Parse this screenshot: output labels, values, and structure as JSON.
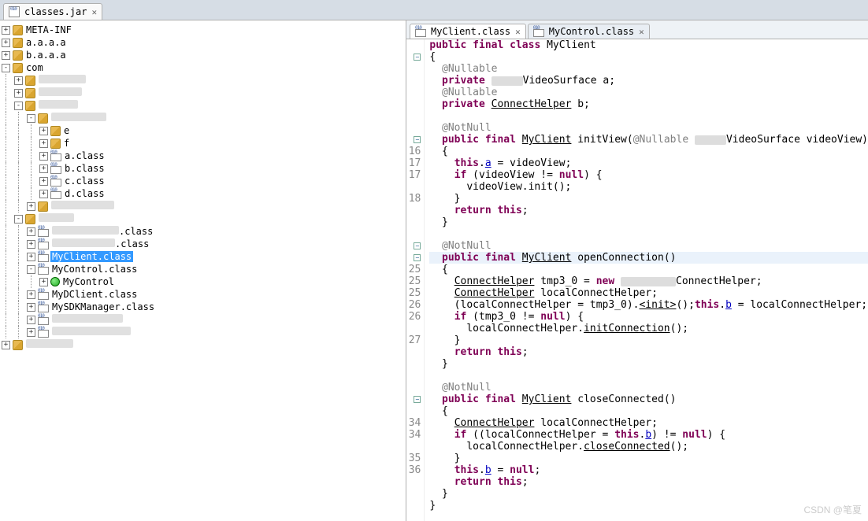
{
  "topTab": {
    "title": "classes.jar"
  },
  "tree": [
    {
      "d": 0,
      "exp": "-",
      "icon": "class",
      "label": "",
      "blurW": 0,
      "sel": false,
      "isBlur": false,
      "hideLabel": true
    },
    {
      "d": 0,
      "exp": "+",
      "icon": "pkg",
      "label": "META-INF"
    },
    {
      "d": 0,
      "exp": "+",
      "icon": "pkg",
      "label": "a.a.a.a"
    },
    {
      "d": 0,
      "exp": "+",
      "icon": "pkg",
      "label": "b.a.a.a"
    },
    {
      "d": 0,
      "exp": "-",
      "icon": "pkg",
      "label": "com"
    },
    {
      "d": 1,
      "exp": "+",
      "icon": "pkg",
      "label": "",
      "isBlur": true,
      "blurW": 60
    },
    {
      "d": 1,
      "exp": "+",
      "icon": "pkg",
      "label": "",
      "isBlur": true,
      "blurW": 55
    },
    {
      "d": 1,
      "exp": "-",
      "icon": "pkg",
      "label": "",
      "isBlur": true,
      "blurW": 50
    },
    {
      "d": 2,
      "exp": "-",
      "icon": "pkg",
      "label": "",
      "isBlur": true,
      "blurW": 70
    },
    {
      "d": 3,
      "exp": "+",
      "icon": "pkg",
      "label": "e"
    },
    {
      "d": 3,
      "exp": "+",
      "icon": "pkg",
      "label": "f"
    },
    {
      "d": 3,
      "exp": "+",
      "icon": "class",
      "label": "a.class"
    },
    {
      "d": 3,
      "exp": "+",
      "icon": "class",
      "label": "b.class"
    },
    {
      "d": 3,
      "exp": "+",
      "icon": "class",
      "label": "c.class"
    },
    {
      "d": 3,
      "exp": "+",
      "icon": "class",
      "label": "d.class"
    },
    {
      "d": 2,
      "exp": "+",
      "icon": "pkg",
      "label": "",
      "isBlur": true,
      "blurW": 80
    },
    {
      "d": 1,
      "exp": "-",
      "icon": "pkg",
      "label": "",
      "isBlur": true,
      "blurW": 45
    },
    {
      "d": 2,
      "exp": "+",
      "icon": "class",
      "label": ".class",
      "prefixBlur": 85
    },
    {
      "d": 2,
      "exp": "+",
      "icon": "class",
      "label": ".class",
      "prefixBlur": 80
    },
    {
      "d": 2,
      "exp": "+",
      "icon": "class",
      "label": "MyClient.class",
      "sel": true
    },
    {
      "d": 2,
      "exp": "-",
      "icon": "class",
      "label": "MyControl.class"
    },
    {
      "d": 3,
      "exp": "+",
      "icon": "green",
      "label": "MyControl"
    },
    {
      "d": 2,
      "exp": "+",
      "icon": "class",
      "label": "MyDClient.class"
    },
    {
      "d": 2,
      "exp": "+",
      "icon": "class",
      "label": "MySDKManager.class"
    },
    {
      "d": 2,
      "exp": "+",
      "icon": "class",
      "label": "",
      "isBlur": true,
      "blurW": 90
    },
    {
      "d": 2,
      "exp": "+",
      "icon": "class",
      "label": "",
      "isBlur": true,
      "blurW": 100
    },
    {
      "d": 0,
      "exp": "+",
      "icon": "pkg",
      "label": "",
      "isBlur": true,
      "blurW": 60
    }
  ],
  "editorTabs": [
    {
      "label": "MyClient.class",
      "active": true
    },
    {
      "label": "MyControl.class",
      "active": false
    }
  ],
  "gutter": [
    "",
    "",
    "",
    "",
    "",
    "",
    "",
    "",
    "",
    "16",
    "17",
    "17",
    "",
    "18",
    "",
    "",
    "",
    "",
    "",
    "25",
    "25",
    "25",
    "26",
    "26",
    "",
    "27",
    "",
    "",
    "",
    "",
    "",
    "",
    "34",
    "34",
    "",
    "35",
    "36",
    "",
    ""
  ],
  "folds": {
    "1": "-",
    "8": "-",
    "17": "-",
    "18": "-",
    "30": "-"
  },
  "code": [
    {
      "html": "<span class='kw'>public</span> <span class='kw'>final</span> <span class='kw'>class</span> MyClient"
    },
    {
      "html": "{"
    },
    {
      "html": "  <span class='ann'>@Nullable</span>"
    },
    {
      "html": "  <span class='kw'>private</span> <span class='blur-inline'></span>VideoSurface a;"
    },
    {
      "html": "  <span class='ann'>@Nullable</span>"
    },
    {
      "html": "  <span class='kw'>private</span> <span class='typ'>ConnectHelper</span> b;"
    },
    {
      "html": "  "
    },
    {
      "html": "  <span class='ann'>@NotNull</span>"
    },
    {
      "html": "  <span class='kw'>public</span> <span class='kw'>final</span> <span class='typ'>MyClient</span> initView(<span class='ann'>@Nullable</span> <span class='blur-inline'></span>VideoSurface videoView)"
    },
    {
      "html": "  {"
    },
    {
      "html": "    <span class='kw'>this</span>.<span class='fld'>a</span> = videoView;"
    },
    {
      "html": "    <span class='kw'>if</span> (videoView != <span class='kw'>null</span>) {"
    },
    {
      "html": "      videoView.init();"
    },
    {
      "html": "    }"
    },
    {
      "html": "    <span class='kw'>return</span> <span class='kw'>this</span>;"
    },
    {
      "html": "  }"
    },
    {
      "html": "  "
    },
    {
      "html": "  <span class='ann'>@NotNull</span>"
    },
    {
      "html": "  <span class='kw'>public</span> <span class='kw'>final</span> <span class='typ'>MyClient</span> openConnection()",
      "hl": true
    },
    {
      "html": "  {"
    },
    {
      "html": "    <span class='typ'>ConnectHelper</span> tmp3_0 = <span class='kw'>new</span> <span class='blur-inline' style='width:70px'></span>ConnectHelper;"
    },
    {
      "html": "    <span class='typ'>ConnectHelper</span> localConnectHelper;"
    },
    {
      "html": "    (localConnectHelper = tmp3_0).<span class='mtd'>&lt;init&gt;</span>();<span class='kw'>this</span>.<span class='fld'>b</span> = localConnectHelper;"
    },
    {
      "html": "    <span class='kw'>if</span> (tmp3_0 != <span class='kw'>null</span>) {"
    },
    {
      "html": "      localConnectHelper.<span class='mtd'>initConnection</span>();"
    },
    {
      "html": "    }"
    },
    {
      "html": "    <span class='kw'>return</span> <span class='kw'>this</span>;"
    },
    {
      "html": "  }"
    },
    {
      "html": "  "
    },
    {
      "html": "  <span class='ann'>@NotNull</span>"
    },
    {
      "html": "  <span class='kw'>public</span> <span class='kw'>final</span> <span class='typ'>MyClient</span> closeConnected()"
    },
    {
      "html": "  {"
    },
    {
      "html": "    <span class='typ'>ConnectHelper</span> localConnectHelper;"
    },
    {
      "html": "    <span class='kw'>if</span> ((localConnectHelper = <span class='kw'>this</span>.<span class='fld'>b</span>) != <span class='kw'>null</span>) {"
    },
    {
      "html": "      localConnectHelper.<span class='mtd'>closeConnected</span>();"
    },
    {
      "html": "    }"
    },
    {
      "html": "    <span class='kw'>this</span>.<span class='fld'>b</span> = <span class='kw'>null</span>;"
    },
    {
      "html": "    <span class='kw'>return</span> <span class='kw'>this</span>;"
    },
    {
      "html": "  }"
    },
    {
      "html": "}"
    }
  ],
  "watermark": "CSDN @笔夏"
}
